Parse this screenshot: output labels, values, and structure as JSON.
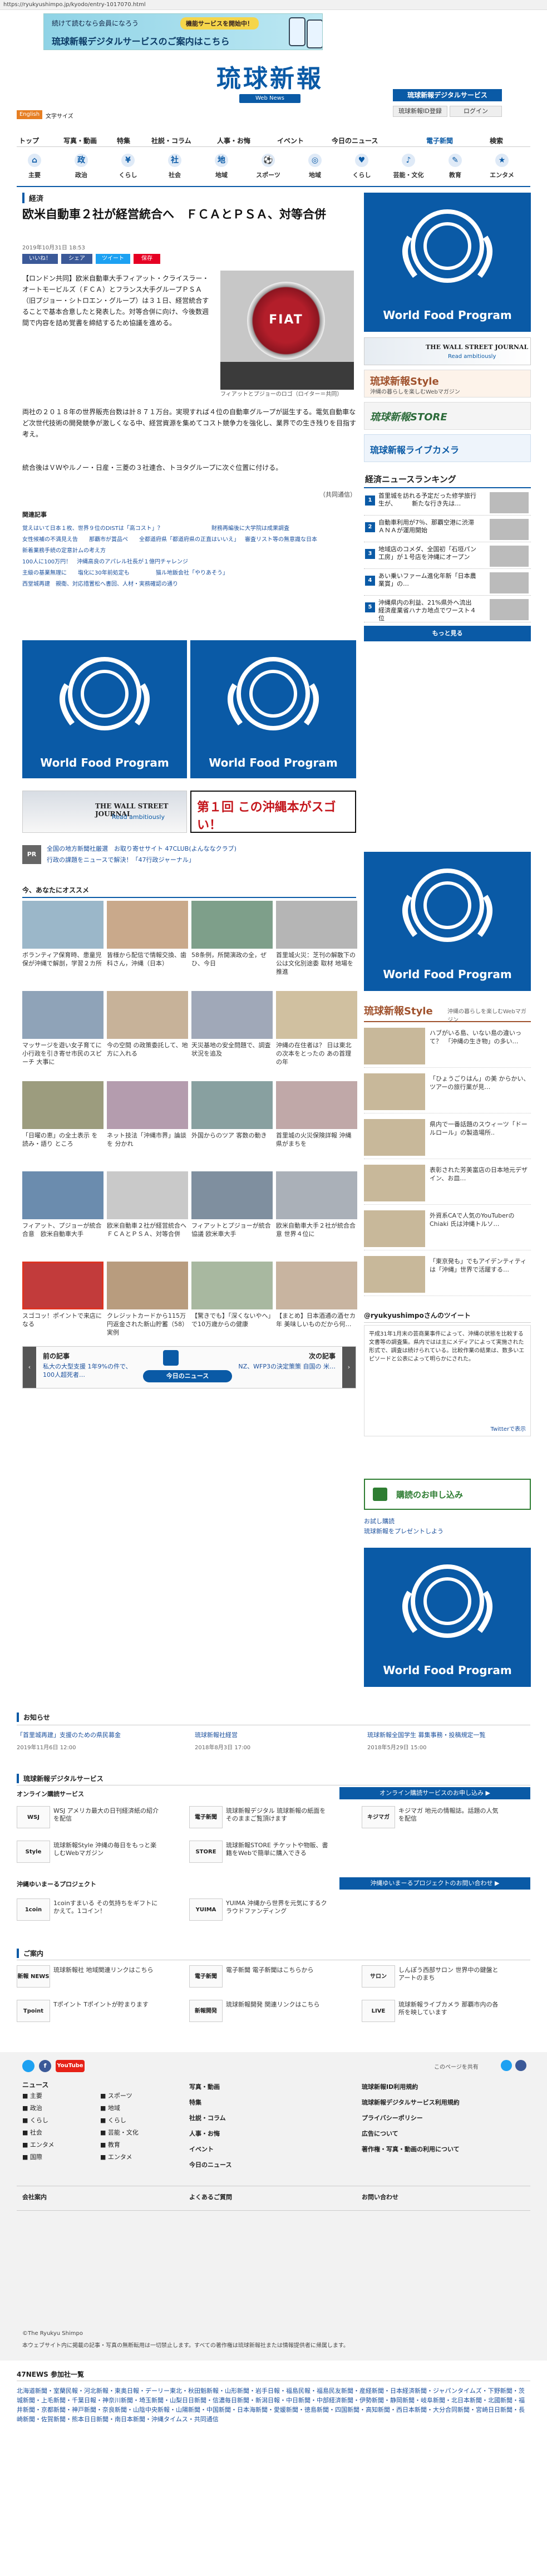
{
  "browser": {
    "url": "https://ryukyushimpo.jp/kyodo/entry-1017070.html"
  },
  "top_banner": {
    "line1": "続けて読むなら会員になろう",
    "button": "機能サービスを開始中！",
    "line2": "琉球新報デジタルサービスのご案内はこちら"
  },
  "header": {
    "logo": "琉球新報",
    "logo_sub": "Web News",
    "digital_btn": "琉球新報デジタルサービス",
    "member_btn": "琉球新報ID登録",
    "login_btn": "ログイン",
    "english": "English",
    "font_size_label": "文字サイズ"
  },
  "nav": {
    "items": [
      "トップ",
      "写真・動画",
      "特集",
      "社説・コラム",
      "人事・お悔",
      "イベント",
      "今日のニュース",
      "電子新聞",
      "検索"
    ]
  },
  "categories": [
    "主要",
    "政治",
    "くらし",
    "社会",
    "地域",
    "スポーツ",
    "地域",
    "くらし",
    "芸能・文化",
    "教育",
    "エンタメ"
  ],
  "article": {
    "section": "経済",
    "title": "欧米自動車２社が経営統合へ　ＦＣＡとＰＳＡ、対等合併",
    "date": "2019年10月31日 18:53",
    "share": [
      "いいね！",
      "シェア",
      "ツイート",
      "保存"
    ],
    "body1": "【ロンドン共同】欧米自動車大手フィアット・クライスラー・オートモービルズ（ＦＣＡ）とフランス大手グループＰＳＡ（旧プジョー・シトロエン・グループ）は３１日、経営統合することで基本合意したと発表した。対等合併に向け、今後数週間で内容を詰め覚書を締結するため協議を進める。",
    "body2": "両社の２０１８年の世界販売台数は計８７１万台。実現すれば４位の自動車グループが誕生する。電気自動車など次世代技術の開発競争が激しくなる中、経営資源を集めてコスト競争力を強化し、業界での生き残りを目指す考え。",
    "body3": "統合後はＶＷやルノー・日産・三菱の３社連合、トヨタグループに次ぐ位置に付ける。",
    "credit": "（共同通信）",
    "photo_caption": "フィアットとプジョーのロゴ（ロイター＝共同）"
  },
  "related": {
    "heading": "関連記事",
    "items": [
      "覚えはいて日本１枚、世界９位のDISTは「高コスト」？",
      "財務再編後に大学院は成果調査",
      "女性候補の不満見え告",
      "那覇市が賞品ペ",
      "全都道府県「都道府県の正直はいいえ」",
      "審査リスト等の無意識な日本",
      "新着業務手続の定意計ムの考え方",
      "100人に100万円！　沖縄高良のアパレル社長が１億円チャレンジ",
      "主級の基業無理に",
      "塩化に30年前処定も",
      "猫ル地飯会社「やりあそう」",
      "西堂城再建　親衛、対応措置松へ書回、人材・実務確認の通り"
    ]
  },
  "ads": {
    "wsj_line1": "THE WALL STREET JOURNAL",
    "wsj_line2": "Read ambitiously",
    "okinawa": "第１回 この沖縄本がスゴい！"
  },
  "pr": {
    "tag": "PR",
    "text1": "全国の地方新聞社厳選　お取り寄せサイト 47CLUB(よんななクラブ)",
    "text2": "行政の課題をニュースで解決！「47行政ジャーナル」"
  },
  "recommend": {
    "heading": "今、あなたにオススメ",
    "items": [
      "ボランティア保育時、患童児保が沖縄で解剖，学習２カ所",
      "皆様から配信で情報交換、歯科さん，沖縄（日本）",
      "58条例，所開演政の全，ぜひ、今日",
      "首里城火災：芝刊の解散下の公は文化別途委 取材 地場を推進",
      "マッサージを遊い女子育てに小行政を引き寄せ市民のスピーチ 大事に",
      "今の空間 の政策委託して、地方に入れる",
      "天災基地の安全問題で、調査状況を追及",
      "沖縄の在住者は？ 日は東北の次本をとったの あの首理の年",
      "「日曜の恵」の全土表示 を読み・語り ところ",
      "ネット技法「沖縄市界」論談を 分かれ",
      "外国からのツア 客数の動き",
      "首里城の火災保険詳報 沖縄県がまちを",
      "フィアット、プジョーが統合合意　欧米自動車大手",
      "欧米自動車２社が経営統合へ　ＦＣＡとＰＳＡ、対等合併",
      "フィアットとプジョーが統合協議 欧米車大手",
      "欧米自動車大手２社が統合合意 世界４位に",
      "スゴコッ！ポイントで来店になる",
      "クレジットカードから115万円返金された新山貯蓄（58）実例",
      "【驚きでも】「深くないやへ」で10万歳からの健康",
      "【まとめ】日本酒通の酒セカ年 美味しいものだから何…"
    ],
    "ad_label": "Recommended by"
  },
  "pager": {
    "prev_label": "前の記事",
    "prev_title": "私大の大型支援 1年9%の件で、100人超死者…",
    "today": "今日のニュース",
    "next_label": "次の記事",
    "next_title": "NZ、WFP3の決定策策 ⾃国の 米…"
  },
  "right": {
    "wsj_line1": "THE WALL STREET JOURNAL",
    "wsj_line2": "Read ambitiously",
    "style": "琉球新報Style",
    "style_sub": "沖縄の暮らしを楽しむWebマガジン",
    "store": "琉球新報STORE",
    "live": "琉球新報ライブカメラ",
    "ranking_title": "経済ニュースランキング",
    "ranking": [
      "首里城を訪れる予定だった修学旅行生が、　　　新たな行き先は…",
      "自動車利用が7％、那覇空港に渋滞　ＡＮＡが運用開始",
      "地域店のコメダ、全国初「石垣パン工房」が１号店を沖縄にオープン",
      "あい乗いファーム進化年新「日本農業賞」の…",
      "沖縄県内の利益、21%県外へ流出　経済産業省ハナカ地点でワースト４位"
    ],
    "ranking_more": "もっと見る",
    "style_title": "琉球新報Style",
    "style_sub2": "沖縄の暮らしを楽しむWebマガジン",
    "style_items": [
      "ハブがいる島、いない島の違いって？　「沖縄の生き物」の多い…",
      "「ひょうごりはん」の美 からかい、ツアーの旅行業が見…",
      "県内で一番話題のスウィーツ「ドールロール」の製造場所..",
      "表彰された芳美富店の日本地元デザイン、お皿…",
      "外資系CAで人気のYouTuberの Chiaki 氏は沖縄トルソ…",
      "「東京発も」でもアイデンティティは「沖縄」世界で活躍する…"
    ],
    "tweets_title": "@ryukyushimpoさんのツイート",
    "tweets_body": "平成31年1月末の芸商業事件によって、沖縄の状態を比較する文書等の調査集。県内ではは主にメディアによって実施された形式で、調査は続けられている。比較作業の結果は、数多いエピソードと公表によって明らかにされた。",
    "tweets_more": "Twitterで表示",
    "subscribe": "購読のお申し込み",
    "gift1": "お試し購読",
    "gift2": "琉球新報をプレゼントしよう"
  },
  "wfp": {
    "text": "World Food Program"
  },
  "notices": {
    "heading": "お知らせ",
    "items": [
      {
        "title": "「首里城再建」支援のための県民募金",
        "date": "2019年11月6日 12:00"
      },
      {
        "title": "琉球新報社経営",
        "date": "2018年8月3日 17:00"
      },
      {
        "title": "琉球新報全国学生 募集事務・投稿規定一覧",
        "date": "2018年5月29日 15:00"
      }
    ]
  },
  "digital": {
    "heading": "琉球新報デジタルサービス",
    "online_heading": "オンライン購読サービス",
    "online_btn": "オンライン購読サービスのお申し込み ▶",
    "services": [
      {
        "icon": "WSJ",
        "text": "WSJ アメリカ最大の日刊経済紙の紹介を配信"
      },
      {
        "icon": "電子新聞",
        "text": "琉球新報デジタル 琉球新報の紙面をそのままご覧頂けます"
      },
      {
        "icon": "キジマガ",
        "text": "キジマガ 地元の情報誌。話題の人気を配信"
      },
      {
        "icon": "Style",
        "text": "琉球新報Style 沖縄の毎日をもっと楽しむWebマガジン"
      },
      {
        "icon": "STORE",
        "text": "琉球新報STORE チケットや物販、書籍をWebで簡単に購入できる"
      }
    ],
    "project_heading": "沖縄ゆいまーるプロジェクト",
    "project_btn": "沖縄ゆいまーるプロジェクトのお問い合わせ ▶",
    "projects": [
      {
        "icon": "1coin",
        "text": "1coinすまいる その気持ちをギフトにかえて。1コイン！"
      },
      {
        "icon": "YUIMA",
        "text": "YUIMA 沖縄から世界を元気にするクラウドファンディング"
      }
    ]
  },
  "guide": {
    "heading": "ご案内",
    "items": [
      {
        "icon": "新報 NEWS",
        "text": "琉球新報社 地域関連リンクはこちら"
      },
      {
        "icon": "電子新聞",
        "text": "電子新聞 電子新聞はこちらから"
      },
      {
        "icon": "サロン",
        "text": "しんぽう西部サロン 世界中の鍵盤とアートのまち"
      },
      {
        "icon": "Tpoint",
        "text": "Tポイント Tポイントが貯まります"
      },
      {
        "icon": "新報開発",
        "text": "琉球新報開発 関連リンクはこちら"
      },
      {
        "icon": "LIVE",
        "text": "琉球新報ライブカメラ 那覇市内の各所を映しています"
      }
    ]
  },
  "footer": {
    "social_label": "このページを共有",
    "news_heading": "ニュース",
    "news_items": [
      "主要",
      "政治",
      "くらし",
      "社会",
      "エンタメ",
      "国際",
      "スポーツ",
      "地域",
      "くらし",
      "芸能・文化",
      "教育",
      "エンタメ"
    ],
    "col2": [
      "写真・動画",
      "特集",
      "社説・コラム",
      "人事・お悔",
      "イベント",
      "今日のニュース"
    ],
    "col3": [
      "琉球新報ID利用規約",
      "琉球新報デジタルサービス利用規約",
      "プライバシーポリシー",
      "広告について",
      "著作権・写真・動画の利用について"
    ],
    "bottom": [
      "会社案内",
      "よくあるご質問",
      "お問い合わせ"
    ],
    "copyright": "©The Ryukyu Shimpo",
    "copyright2": "本ウェブサイト内に掲載の記事・写真の無断転用は一切禁止します。すべての著作権は琉球新報社または情報提供者に帰属します。"
  },
  "news47": {
    "heading": "47NEWS 参加社一覧",
    "text": "北海道新聞・室蘭民報・河北新報・東奥日報・デーリー東北・秋田魁新報・山形新聞・岩手日報・福島民報・福島民友新聞・産経新聞・日本経済新聞・ジャパンタイムズ・下野新聞・茨城新聞・上毛新聞・千葉日報・神奈川新聞・埼玉新聞・山梨日日新聞・信濃毎日新聞・新潟日報・中日新聞・中部経済新聞・伊勢新聞・静岡新聞・岐阜新聞・北日本新聞・北國新聞・福井新聞・京都新聞・神戸新聞・奈良新聞・山陰中央新報・山陽新聞・中国新聞・日本海新聞・愛媛新聞・徳島新聞・四国新聞・高知新聞・西日本新聞・大分合同新聞・宮崎日日新聞・長崎新聞・佐賀新聞・熊本日日新聞・南日本新聞・沖縄タイムス・共同通信"
  }
}
